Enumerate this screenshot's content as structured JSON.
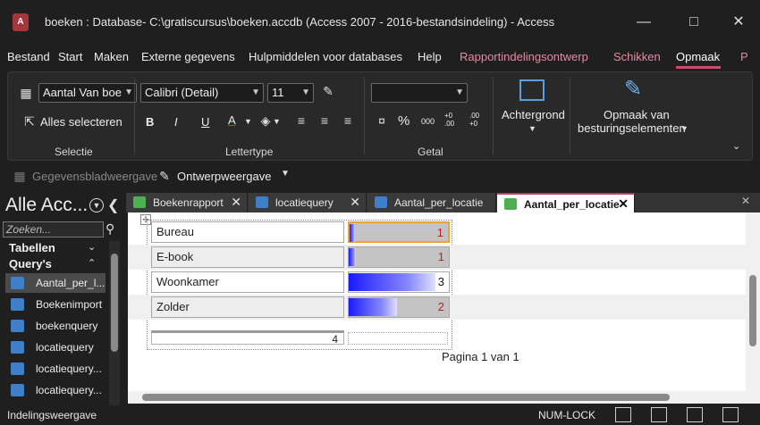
{
  "window": {
    "title": "boeken : Database- C:\\gratiscursus\\boeken.accdb (Access 2007 - 2016-bestandsindeling)  -  Access",
    "app_icon": "A"
  },
  "menu": {
    "tabs": [
      "Bestand",
      "Start",
      "Maken",
      "Externe gegevens",
      "Hulpmiddelen voor databases",
      "Help"
    ],
    "context_tabs": [
      "Rapportindelingsontwerp",
      "Schikken"
    ],
    "active_tab": "Opmaak",
    "overflow": "P"
  },
  "ribbon": {
    "selectie": {
      "object_combo": "Aantal Van boe",
      "select_all": "Alles selecteren",
      "label": "Selectie"
    },
    "lettertype": {
      "font": "Calibri (Detail)",
      "size": "11",
      "bold": "B",
      "italic": "I",
      "underline": "U",
      "font_color": "A",
      "label": "Lettertype"
    },
    "getal": {
      "format": "",
      "percent": "%",
      "thousands": "000",
      "inc_decimal": "+0 .00",
      "dec_decimal": ".00 +0",
      "label": "Getal"
    },
    "achtergrond": {
      "label": "Achtergrond"
    },
    "besturing": {
      "label_line1": "Opmaak van",
      "label_line2": "besturingselementen"
    }
  },
  "views": {
    "datasheet": "Gegevensbladweergave",
    "design": "Ontwerpweergave"
  },
  "nav": {
    "title": "Alle Acc...",
    "search_placeholder": "Zoeken...",
    "categories": {
      "tables": "Tabellen",
      "queries": "Query's"
    },
    "items": [
      "Aantal_per_l...",
      "Boekenimport",
      "boekenquery",
      "locatiequery",
      "locatiequery...",
      "locatiequery..."
    ]
  },
  "doc_tabs": [
    "Boekenrapport",
    "locatiequery",
    "Aantal_per_locatie",
    "Aantal_per_locatie"
  ],
  "report": {
    "rows": [
      {
        "name": "Bureau",
        "value": "1",
        "fraction": 0.06
      },
      {
        "name": "E-book",
        "value": "1",
        "fraction": 0.07
      },
      {
        "name": "Woonkamer",
        "value": "3",
        "fraction": 0.9
      },
      {
        "name": "Zolder",
        "value": "2",
        "fraction": 0.5
      }
    ],
    "total": "4",
    "page_label": "Pagina 1 van 1"
  },
  "status": {
    "mode": "Indelingsweergave",
    "numlock": "NUM-LOCK"
  },
  "colors": {
    "accent": "#d04a6b",
    "bar": "#1a1aff",
    "selection": "#f0a030"
  }
}
